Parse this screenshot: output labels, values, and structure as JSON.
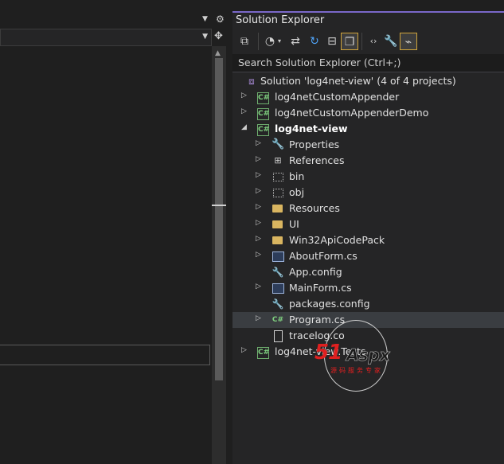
{
  "solution_explorer": {
    "title": "Solution Explorer",
    "search_placeholder": "Search Solution Explorer (Ctrl+;)",
    "toolbar": [
      {
        "icon": "vs-switch-views-icon"
      },
      {
        "icon": "history-icon"
      },
      {
        "icon": "sync-icon"
      },
      {
        "icon": "refresh-icon"
      },
      {
        "icon": "collapse-all-icon"
      },
      {
        "icon": "show-all-files-icon"
      },
      {
        "icon": "code-view-icon"
      },
      {
        "icon": "properties-wrench-icon"
      },
      {
        "icon": "preview-selected-items-icon"
      }
    ],
    "tree": [
      {
        "label": "Solution 'log4net-view' (4 of 4 projects)",
        "icon": "solution-icon",
        "level": 0,
        "arrow": "",
        "bold": false,
        "selected": false
      },
      {
        "label": "log4netCustomAppender",
        "icon": "csharp-project-icon",
        "level": 0,
        "arrow": "collapsed",
        "bold": false,
        "selected": false
      },
      {
        "label": "log4netCustomAppenderDemo",
        "icon": "csharp-project-icon",
        "level": 0,
        "arrow": "collapsed",
        "bold": false,
        "selected": false
      },
      {
        "label": "log4net-view",
        "icon": "csharp-project-icon",
        "level": 0,
        "arrow": "expanded",
        "bold": true,
        "selected": false
      },
      {
        "label": "Properties",
        "icon": "wrench-icon",
        "level": 1,
        "arrow": "collapsed",
        "bold": false,
        "selected": false
      },
      {
        "label": "References",
        "icon": "references-icon",
        "level": 1,
        "arrow": "collapsed",
        "bold": false,
        "selected": false
      },
      {
        "label": "bin",
        "icon": "dotted-folder-icon",
        "level": 1,
        "arrow": "collapsed",
        "bold": false,
        "selected": false
      },
      {
        "label": "obj",
        "icon": "dotted-folder-icon",
        "level": 1,
        "arrow": "collapsed",
        "bold": false,
        "selected": false
      },
      {
        "label": "Resources",
        "icon": "folder-icon",
        "level": 1,
        "arrow": "collapsed",
        "bold": false,
        "selected": false
      },
      {
        "label": "UI",
        "icon": "folder-icon",
        "level": 1,
        "arrow": "collapsed",
        "bold": false,
        "selected": false
      },
      {
        "label": "Win32ApiCodePack",
        "icon": "folder-icon",
        "level": 1,
        "arrow": "collapsed",
        "bold": false,
        "selected": false
      },
      {
        "label": "AboutForm.cs",
        "icon": "form-icon",
        "level": 1,
        "arrow": "collapsed",
        "bold": false,
        "selected": false
      },
      {
        "label": "App.config",
        "icon": "config-icon",
        "level": 1,
        "arrow": "",
        "bold": false,
        "selected": false
      },
      {
        "label": "MainForm.cs",
        "icon": "form-icon",
        "level": 1,
        "arrow": "collapsed",
        "bold": false,
        "selected": false
      },
      {
        "label": "packages.config",
        "icon": "config-icon",
        "level": 1,
        "arrow": "",
        "bold": false,
        "selected": false
      },
      {
        "label": "Program.cs",
        "icon": "csharp-file-icon",
        "level": 1,
        "arrow": "collapsed",
        "bold": false,
        "selected": true
      },
      {
        "label": "tracelog.co",
        "icon": "file-icon",
        "level": 1,
        "arrow": "",
        "bold": false,
        "selected": false
      },
      {
        "label": "log4net-view.Tests",
        "icon": "csharp-project-icon",
        "level": 0,
        "arrow": "collapsed",
        "bold": false,
        "selected": false
      }
    ]
  },
  "watermark": {
    "brand": "51",
    "brand2": "Aspx",
    "sub": "源码服务专家"
  },
  "colors": {
    "accent": "#7a68c9",
    "selection": "#3a3d41",
    "folder": "#d9b560",
    "csharp": "#7fcf7f"
  }
}
